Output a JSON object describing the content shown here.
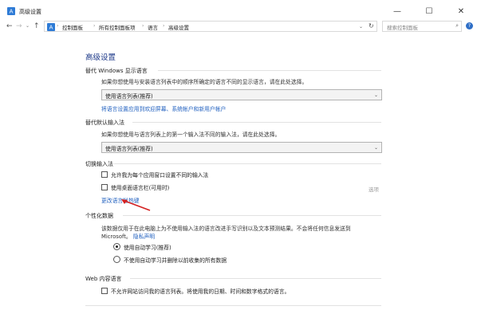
{
  "window": {
    "title": "高级设置",
    "controls": [
      "—",
      "☐",
      "✕"
    ]
  },
  "nav": {
    "back": "←",
    "forward": "→",
    "dropdown": "⌄",
    "up": "↑",
    "breadcrumb": [
      "控制面板",
      "所有控制面板项",
      "语言",
      "高级设置"
    ],
    "breadcrumb_sep": "›",
    "search_placeholder": "搜索控制面板",
    "refresh": "↻",
    "help": "?"
  },
  "page": {
    "title": "高级设置",
    "sections": {
      "display_language": {
        "title": "替代 Windows 显示语言",
        "desc": "如果你想使用与安装语言列表中的顺序所确定的语言不同的显示语言，请在此处选择。",
        "select_value": "使用语言列表(推荐)",
        "link": "将语言设置应用到欢迎屏幕、系统帐户和新用户帐户"
      },
      "input_method": {
        "title": "替代默认输入法",
        "desc": "如果你想使用与语言列表上的第一个输入法不同的输入法，请在此处选择。",
        "select_value": "使用语言列表(推荐)"
      },
      "switch_input": {
        "title": "切换输入法",
        "checkbox1": "允许我为每个应用窗口设置不同的输入法",
        "checkbox2": "使用桌面语言栏(可用时)",
        "options": "选项",
        "link": "更改语言栏热键"
      },
      "personalization": {
        "title": "个性化数据",
        "desc_line1": "该数据仅用于在此电脑上为不使用输入法的语言改进手写识别以及文本预测结果。不会将任何信息发送到",
        "desc_line2_prefix": "Microsoft。",
        "privacy_link": "隐私声明",
        "radio1": "使用自动学习(推荐)",
        "radio2": "不使用自动学习并删除以前收集的所有数据"
      },
      "web_language": {
        "title": "Web 内容语言",
        "checkbox": "不允许网站访问我的语言列表。将使用我的日期、时间和数字格式的语言。"
      }
    }
  },
  "colors": {
    "link": "#1f5fbf",
    "heading": "#1e3a8a",
    "annotation_arrow": "#d42020"
  }
}
